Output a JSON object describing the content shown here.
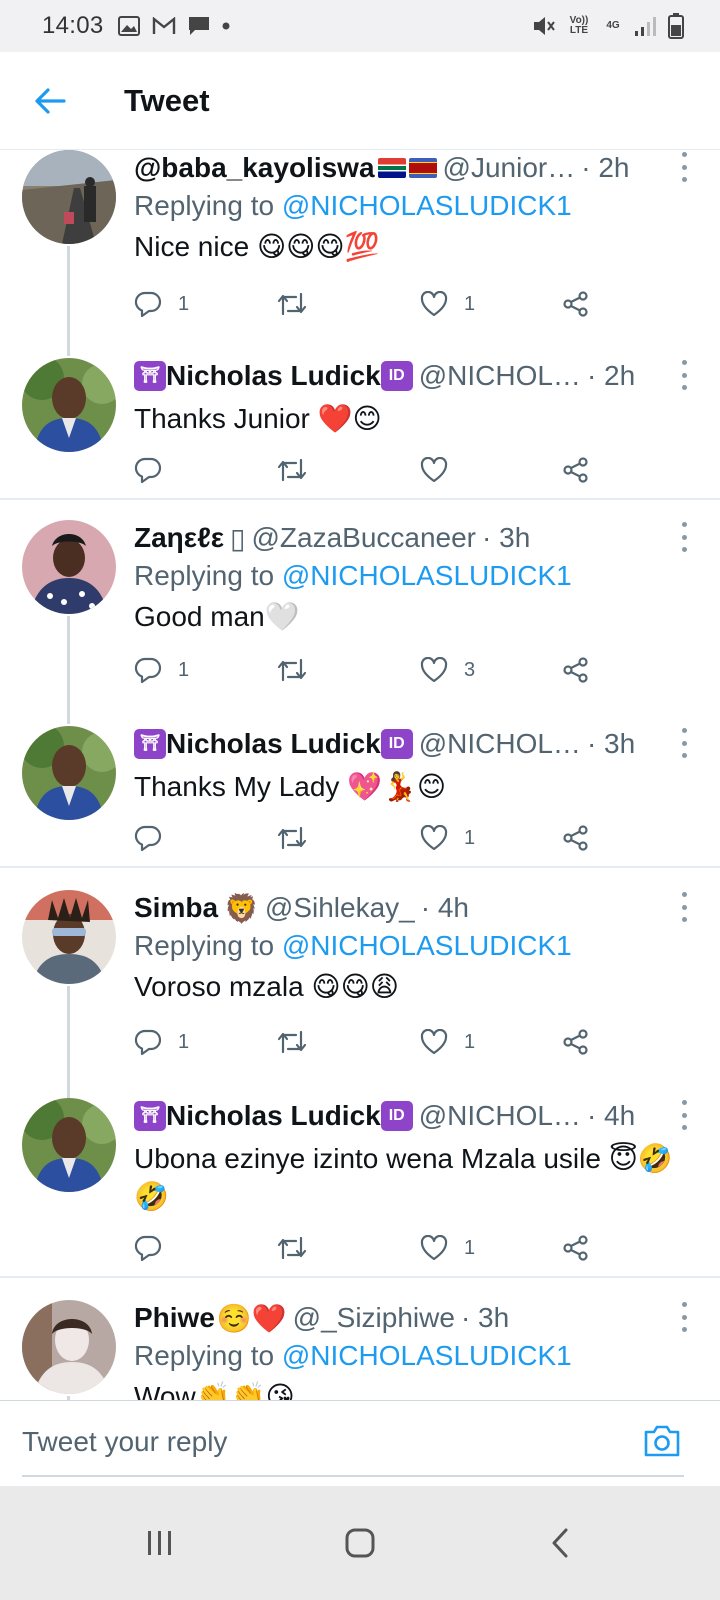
{
  "status_bar": {
    "time": "14:03",
    "left_icons": [
      "image-icon",
      "gmail-icon",
      "chat-icon",
      "dot-icon"
    ],
    "volte": "Vo)) LTE",
    "network": "4G"
  },
  "header": {
    "title": "Tweet"
  },
  "tweets": [
    {
      "name": "@baba_kayoliswa",
      "name_suffix": "🇿🇦🇸🇿",
      "handle": "@Junior…",
      "time": "· 2h",
      "replying_prefix": "Replying to ",
      "replying_to": "@NICHOLASLUDICK1",
      "text": "Nice nice 😋😋😋💯",
      "replies": "1",
      "retweets": "",
      "likes": "1"
    },
    {
      "name": "Nicholas Ludick",
      "name_prefix_badge": "🛐",
      "name_suffix_badge": "ID",
      "handle": "@NICHOL…",
      "time": "· 2h",
      "text": "Thanks Junior ❤️😊",
      "replies": "",
      "retweets": "",
      "likes": ""
    },
    {
      "name": "Zaηεℓε",
      "name_suffix": "▯",
      "handle": "@ZazaBuccaneer",
      "time": "· 3h",
      "replying_prefix": "Replying to ",
      "replying_to": "@NICHOLASLUDICK1",
      "text": "Good man🤍",
      "replies": "1",
      "retweets": "",
      "likes": "3"
    },
    {
      "name": "Nicholas Ludick",
      "name_prefix_badge": "🛐",
      "name_suffix_badge": "ID",
      "handle": "@NICHOL…",
      "time": "· 3h",
      "text": "Thanks My Lady 💖💃😊",
      "replies": "",
      "retweets": "",
      "likes": "1"
    },
    {
      "name": "Simba",
      "name_suffix": "🦁",
      "handle": "@Sihlekay_",
      "time": "· 4h",
      "replying_prefix": "Replying to ",
      "replying_to": "@NICHOLASLUDICK1",
      "text": "Voroso mzala 😋😋😩",
      "replies": "1",
      "retweets": "",
      "likes": "1"
    },
    {
      "name": "Nicholas Ludick",
      "name_prefix_badge": "🛐",
      "name_suffix_badge": "ID",
      "handle": "@NICHOL…",
      "time": "· 4h",
      "text": "Ubona ezinye izinto wena Mzala usile 😇🤣🤣",
      "replies": "",
      "retweets": "",
      "likes": "1"
    },
    {
      "name": "Phiwe",
      "name_suffix": "☺️❤️",
      "handle": "@_Siziphiwe",
      "time": "· 3h",
      "replying_prefix": "Replying to ",
      "replying_to": "@NICHOLASLUDICK1",
      "text": "Wow👏👏😘"
    }
  ],
  "reply_bar": {
    "placeholder": "Tweet your reply"
  },
  "nav_bar": {
    "buttons": [
      "recents-icon",
      "home-icon",
      "back-icon"
    ]
  },
  "colors": {
    "accent": "#1d9bf0",
    "secondary_text": "#536471",
    "divider": "#e6ecf0"
  }
}
